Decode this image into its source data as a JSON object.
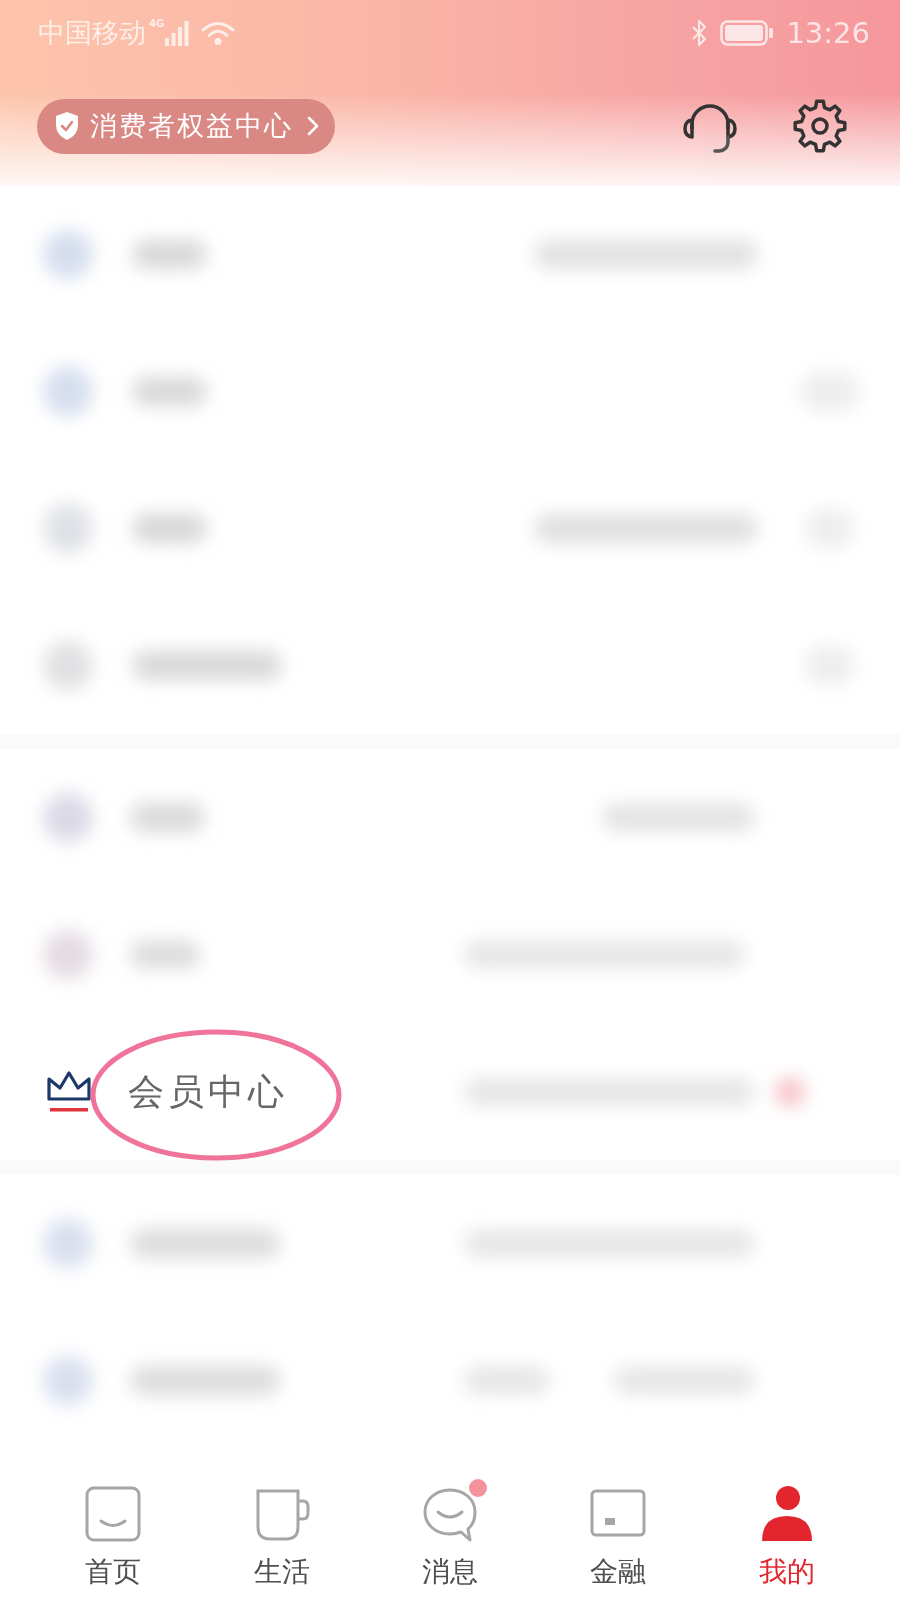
{
  "status_bar": {
    "carrier": "中国移动",
    "network": "4G",
    "time": "13:26"
  },
  "header": {
    "rights_button": "消费者权益中心"
  },
  "menu": {
    "groups": [
      {
        "rows": [
          {
            "kind": "blurred",
            "circled": false
          },
          {
            "kind": "blurred",
            "circled": false
          },
          {
            "kind": "blurred",
            "circled": false
          },
          {
            "kind": "blurred",
            "circled": false
          }
        ]
      },
      {
        "rows": [
          {
            "kind": "blurred",
            "circled": false
          },
          {
            "kind": "blurred",
            "circled": false
          },
          {
            "kind": "item",
            "label": "会员中心",
            "circled": true
          }
        ]
      },
      {
        "rows": [
          {
            "kind": "blurred",
            "circled": false
          },
          {
            "kind": "blurred",
            "circled": false
          }
        ]
      }
    ]
  },
  "tab_bar": [
    {
      "kind": "home",
      "label": "首页",
      "selected": false,
      "badge": false
    },
    {
      "kind": "life",
      "label": "生活",
      "selected": false,
      "badge": false
    },
    {
      "kind": "message",
      "label": "消息",
      "selected": false,
      "badge": true
    },
    {
      "kind": "finance",
      "label": "金融",
      "selected": false,
      "badge": false
    },
    {
      "kind": "profile",
      "label": "我的",
      "selected": true,
      "badge": false
    }
  ]
}
